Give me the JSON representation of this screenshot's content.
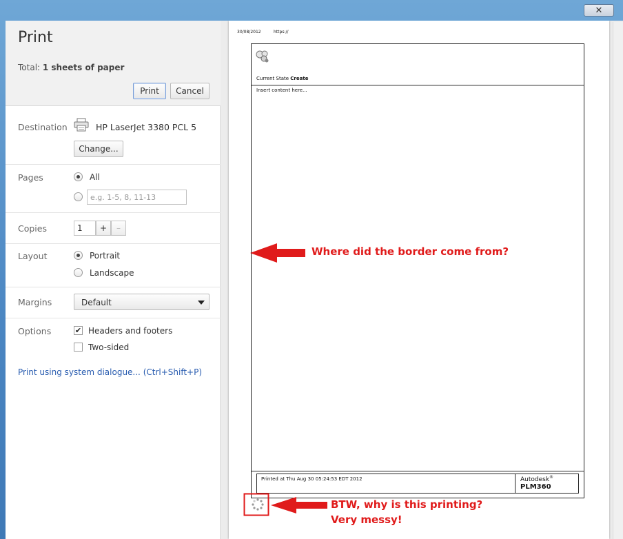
{
  "window": {
    "close_label": "✕"
  },
  "dialog": {
    "title": "Print",
    "total_prefix": "Total: ",
    "total_value": "1 sheets of paper",
    "print_label": "Print",
    "cancel_label": "Cancel"
  },
  "destination": {
    "label": "Destination",
    "printer_name": "HP LaserJet 3380 PCL 5",
    "icon": "printer-icon",
    "change_label": "Change..."
  },
  "pages": {
    "label": "Pages",
    "all_label": "All",
    "range_placeholder": "e.g. 1-5, 8, 11-13"
  },
  "copies": {
    "label": "Copies",
    "value": "1",
    "plus": "+",
    "minus": "–"
  },
  "layout": {
    "label": "Layout",
    "portrait_label": "Portrait",
    "landscape_label": "Landscape"
  },
  "margins": {
    "label": "Margins",
    "selected": "Default"
  },
  "options": {
    "label": "Options",
    "headers_footers_label": "Headers and footers",
    "headers_footers_checked": "✔",
    "two_sided_label": "Two-sided"
  },
  "system_dialog_link": "Print using system dialogue... (Ctrl+Shift+P)",
  "preview": {
    "header_date": "30/08/2012",
    "header_url": "https://",
    "current_state_label": "Current State",
    "current_state_value": "Create",
    "body_text": "Insert content here...",
    "footer_printed": "Printed at Thu Aug 30 05:24:53 EDT 2012",
    "brand_top": "Autodesk",
    "brand_mark": "®",
    "brand_product": "PLM360"
  },
  "annotations": {
    "border_question": "Where did the border come from?",
    "btw_line1": "BTW, why is this printing?",
    "btw_line2": "Very messy!"
  },
  "colors": {
    "annotation": "#e01b1b",
    "link": "#2a5db0"
  }
}
